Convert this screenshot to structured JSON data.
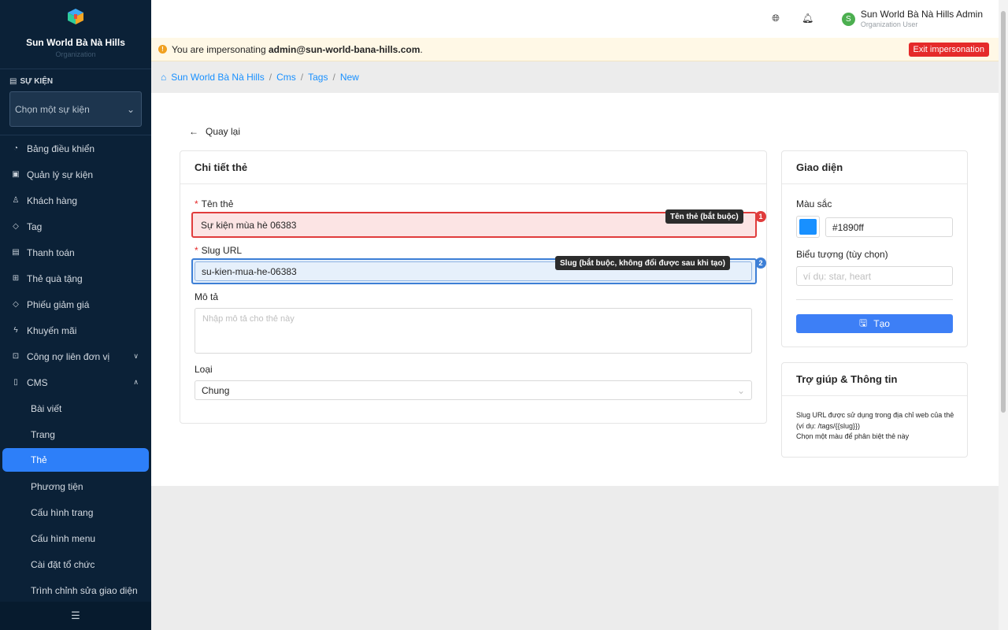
{
  "sidebar": {
    "org_name": "Sun World Bà Nà Hills",
    "org_sub": "Organization",
    "event_section_label": "SỰ KIỆN",
    "event_select_placeholder": "Chọn một sự kiện",
    "menu": [
      {
        "label": "Bảng điều khiển",
        "icon": "dashboard-icon"
      },
      {
        "label": "Quản lý sự kiện",
        "icon": "calendar-icon"
      },
      {
        "label": "Khách hàng",
        "icon": "users-icon"
      },
      {
        "label": "Tag",
        "icon": "tag-icon"
      },
      {
        "label": "Thanh toán",
        "icon": "payment-icon"
      },
      {
        "label": "Thẻ quà tặng",
        "icon": "gift-icon"
      },
      {
        "label": "Phiếu giảm giá",
        "icon": "coupon-icon"
      },
      {
        "label": "Khuyến mãi",
        "icon": "promotion-icon"
      },
      {
        "label": "Công nợ liên đơn vị",
        "icon": "debt-icon"
      },
      {
        "label": "CMS",
        "icon": "cms-icon"
      }
    ],
    "cms_sub": [
      {
        "label": "Bài viết"
      },
      {
        "label": "Trang"
      },
      {
        "label": "Thẻ"
      },
      {
        "label": "Phương tiện"
      },
      {
        "label": "Cấu hình trang"
      },
      {
        "label": "Cấu hình menu"
      },
      {
        "label": "Cài đặt tổ chức"
      },
      {
        "label": "Trình chỉnh sửa giao diện"
      }
    ]
  },
  "header": {
    "user_name": "Sun World Bà Nà Hills Admin",
    "user_role": "Organization User",
    "avatar_letter": "S"
  },
  "impersonation": {
    "prefix": "You are impersonating",
    "email": "admin@sun-world-bana-hills.com",
    "suffix": ".",
    "exit_label": "Exit impersonation"
  },
  "breadcrumb": [
    "Sun World Bà Nà Hills",
    "Cms",
    "Tags",
    "New"
  ],
  "back_label": "Quay lại",
  "detail_card": {
    "title": "Chi tiết thẻ",
    "name_label": "Tên thẻ",
    "name_value": "Sự kiện mùa hè 06383",
    "name_tip": "Tên thẻ (bắt buộc)",
    "slug_label": "Slug URL",
    "slug_value": "su-kien-mua-he-06383",
    "slug_tip": "Slug (bắt buộc, không đổi được sau khi tạo)",
    "desc_label": "Mô tả",
    "desc_placeholder": "Nhập mô tả cho thẻ này",
    "type_label": "Loại",
    "type_value": "Chung",
    "badge1": "1",
    "badge2": "2"
  },
  "appearance_card": {
    "title": "Giao diện",
    "color_label": "Màu sắc",
    "color_value": "#1890ff",
    "icon_label": "Biểu tượng (tùy chọn)",
    "icon_placeholder": "ví dụ: star, heart",
    "create_label": "Tạo"
  },
  "help_card": {
    "title": "Trợ giúp & Thông tin",
    "line1": "Slug URL được sử dụng trong địa chỉ web của thẻ",
    "line2": "(ví dụ: /tags/{{slug}})",
    "line3": "Chọn một màu để phân biệt thẻ này"
  }
}
